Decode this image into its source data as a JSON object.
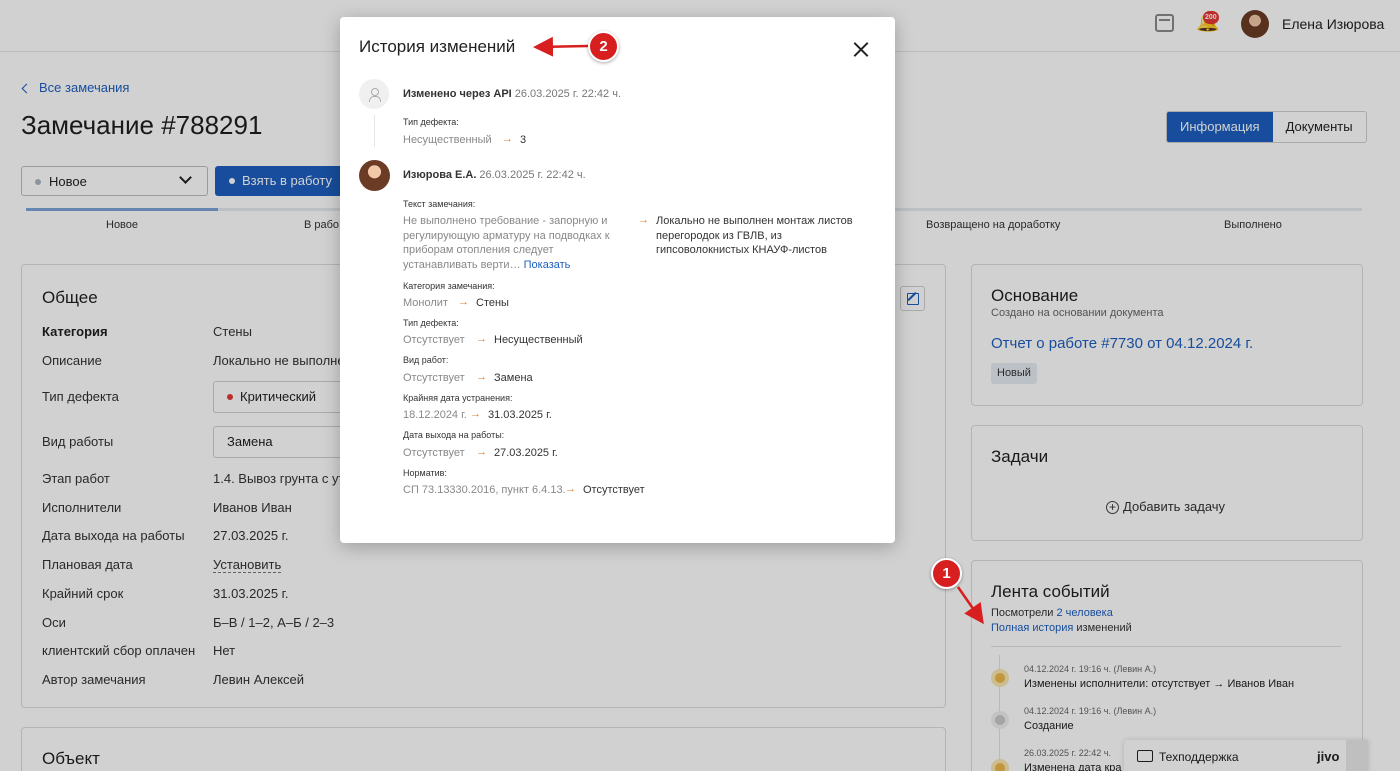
{
  "header": {
    "notifications_badge": "200",
    "user_name": "Елена Изюрова"
  },
  "page": {
    "back_link": "Все замечания",
    "title": "Замечание #788291",
    "tabs": [
      "Информация",
      "Документы"
    ],
    "status_select": "Новое",
    "take_button": "Взять в работу",
    "steps": [
      "Новое",
      "В рабо",
      "Возвращено на доработку",
      "Выполнено"
    ],
    "progress_fraction": 0.14
  },
  "general": {
    "title": "Общее",
    "rows": [
      {
        "key": "Категория",
        "value": "Стены"
      },
      {
        "key": "Описание",
        "value": "Локально не выполне"
      },
      {
        "key": "Тип дефекта",
        "value": "Критический"
      },
      {
        "key": "Вид работы",
        "value": "Замена"
      },
      {
        "key": "Этап работ",
        "value": "1.4. Вывоз грунта с ут"
      },
      {
        "key": "Исполнители",
        "value": "Иванов Иван"
      },
      {
        "key": "Дата выхода на работы",
        "value": "27.03.2025 г."
      },
      {
        "key": "Плановая дата",
        "value": "Установить"
      },
      {
        "key": "Крайний срок",
        "value": "31.03.2025 г."
      },
      {
        "key": "Оси",
        "value": "Б–В / 1–2, А–Б / 2–3"
      },
      {
        "key": "клиентский сбор оплачен",
        "value": "Нет"
      },
      {
        "key": "Автор замечания",
        "value": "Левин Алексей"
      }
    ]
  },
  "object_card": {
    "title": "Объект"
  },
  "basis": {
    "title": "Основание",
    "subtitle": "Создано на основании документа",
    "link": "Отчет о работе #7730 от 04.12.2024 г.",
    "badge": "Новый"
  },
  "tasks": {
    "title": "Задачи",
    "add_label": "Добавить задачу"
  },
  "feed": {
    "title": "Лента событий",
    "viewed_prefix": "Посмотрели",
    "viewed_link": "2 человека",
    "history_link": "Полная история",
    "history_suffix": "изменений",
    "events": [
      {
        "meta": "04.12.2024 г. 19:16 ч. (Левин А.)",
        "text": "Изменены исполнители: отсутствует → Иванов Иван",
        "color": "#f0b84a"
      },
      {
        "meta": "04.12.2024 г. 19:16 ч. (Левин А.)",
        "text": "Создание",
        "color": "#c9c9c9"
      },
      {
        "meta": "26.03.2025 г. 22:42 ч.",
        "text": "Изменена дата кра",
        "color": "#f0b84a"
      }
    ]
  },
  "support": {
    "label": "Техподдержка",
    "logo": "jivo"
  },
  "modal": {
    "title": "История изменений",
    "arrow": "→",
    "entry1": {
      "author": "Изменено через API",
      "date": "26.03.2025 г. 22:42 ч.",
      "field": "Тип дефекта:",
      "old": "Несущественный",
      "new": "3"
    },
    "entry2": {
      "author": "Изюрова Е.А.",
      "date": "26.03.2025 г. 22:42 ч.",
      "text_field": "Текст замечания:",
      "text_old": "Не выполнено требование - запорную и регулирующую арматуру на подводках к приборам отопления следует устанавливать верти…",
      "text_show": "Показать",
      "text_new": "Локально не выполнен монтаж листов перегородок из ГВЛВ, из гипсоволокнистых КНАУФ-листов",
      "changes": [
        {
          "field": "Категория замечания:",
          "old": "Монолит",
          "new": "Стены"
        },
        {
          "field": "Тип дефекта:",
          "old": "Отсутствует",
          "new": "Несущественный"
        },
        {
          "field": "Вид работ:",
          "old": "Отсутствует",
          "new": "Замена"
        },
        {
          "field": "Крайняя дата устранения:",
          "old": "18.12.2024 г.",
          "new": "31.03.2025 г."
        },
        {
          "field": "Дата выхода на работы:",
          "old": "Отсутствует",
          "new": "27.03.2025 г."
        },
        {
          "field": "Норматив:",
          "old": "СП 73.13330.2016, пункт 6.4.13.",
          "new": "Отсутствует"
        }
      ]
    }
  },
  "markers": [
    "1",
    "2"
  ],
  "colors": {
    "accent": "#1d5fbf",
    "marker": "#d81f1f",
    "change_arrow": "#e07a25",
    "critical_dot": "#e53935"
  }
}
